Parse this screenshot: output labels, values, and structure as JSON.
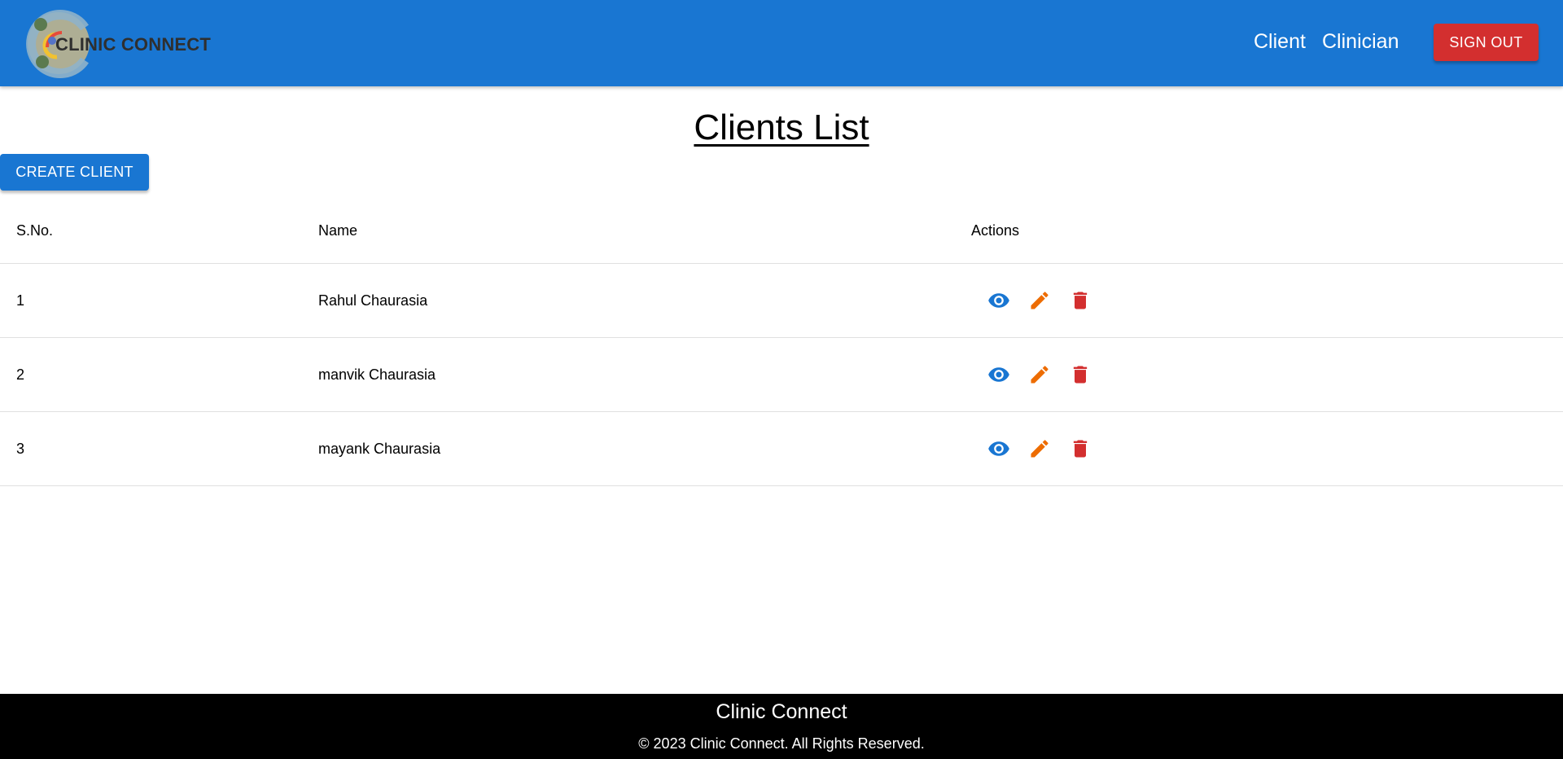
{
  "header": {
    "logo_text": "CLINIC CONNECT",
    "nav": [
      {
        "label": "Client"
      },
      {
        "label": "Clinician"
      }
    ],
    "sign_out_label": "SIGN OUT",
    "colors": {
      "appbar": "#1976d2",
      "sign_out": "#d32f2f"
    }
  },
  "main": {
    "title": "Clients List",
    "create_button_label": "CREATE CLIENT",
    "table": {
      "headers": [
        "S.No.",
        "Name",
        "Actions"
      ],
      "rows": [
        {
          "sno": "1",
          "name": "Rahul Chaurasia",
          "actions": [
            "view-icon",
            "edit-icon",
            "delete-icon"
          ]
        },
        {
          "sno": "2",
          "name": "manvik Chaurasia",
          "actions": [
            "view-icon",
            "edit-icon",
            "delete-icon"
          ]
        },
        {
          "sno": "3",
          "name": "mayank Chaurasia",
          "actions": [
            "view-icon",
            "edit-icon",
            "delete-icon"
          ]
        }
      ]
    },
    "icon_colors": {
      "view": "#1976d2",
      "edit": "#ed6c02",
      "delete": "#d32f2f"
    }
  },
  "footer": {
    "title": "Clinic Connect",
    "copyright": "© 2023 Clinic Connect. All Rights Reserved."
  }
}
